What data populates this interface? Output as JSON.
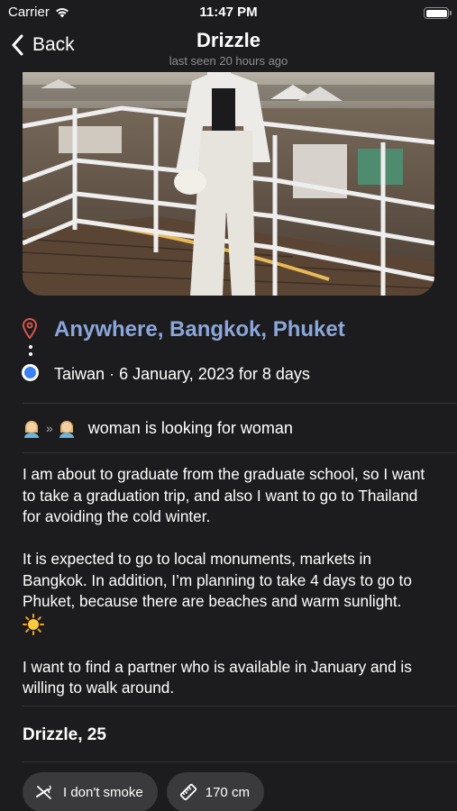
{
  "status_bar": {
    "carrier": "Carrier",
    "time": "11:47 PM",
    "battery_level": 1.0
  },
  "nav": {
    "back_label": "Back",
    "title": "Drizzle",
    "subtitle": "last seen 20 hours ago"
  },
  "trip": {
    "destination": "Anywhere, Bangkok, Phuket",
    "origin": "Taiwan",
    "separator": "·",
    "dates": "6 January, 2023 for 8 days"
  },
  "looking_for": {
    "from_icon": "woman-emoji",
    "arrow": "»",
    "to_icon": "woman-emoji",
    "text": "woman is looking for woman"
  },
  "description": {
    "p1": "I am about to graduate from the graduate school, so I want to take a graduation trip, and also I want to go to Thailand for avoiding the cold winter.",
    "p2": "It is expected to go to local monuments, markets in Bangkok. In addition, I’m planning to take 4 days to go to Phuket, because there are beaches and  warm sunlight.",
    "p3": "I want to find a partner who is available in January and is willing to walk around."
  },
  "profile": {
    "name_age": "Drizzle, 25"
  },
  "chips": [
    {
      "icon": "no-smoking-icon",
      "label": "I don't smoke"
    },
    {
      "icon": "ruler-icon",
      "label": "170 cm"
    }
  ],
  "colors": {
    "background": "#1c1c1e",
    "accent_blue": "#8aa6db",
    "pin_red": "#d9534f",
    "origin_blue": "#3b82f6",
    "chip_bg": "#3a3a3c"
  }
}
